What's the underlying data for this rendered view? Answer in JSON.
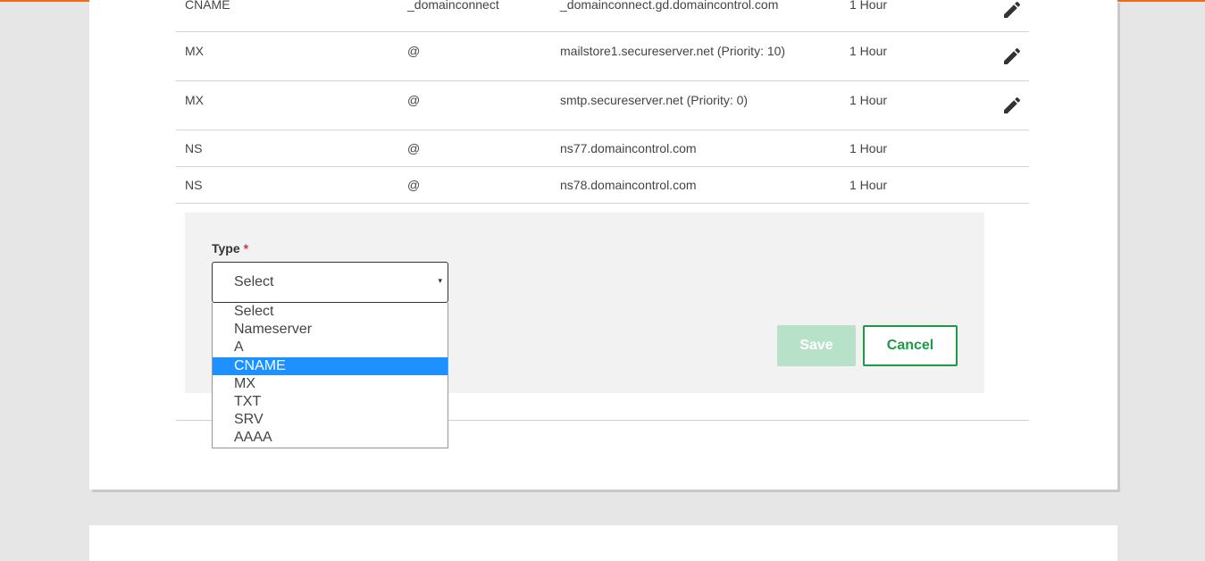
{
  "colors": {
    "accent": "#f16a17",
    "selected_option": "#1e90ff",
    "brand_green": "#1c9a47",
    "save_disabled": "#b7e1c9"
  },
  "records": [
    {
      "type": "CNAME",
      "name": "_domainconnect",
      "value": "_domainconnect.gd.domaincontrol.com",
      "ttl": "1 Hour",
      "editable": true
    },
    {
      "type": "MX",
      "name": "@",
      "value": "mailstore1.secureserver.net (Priority: 10)",
      "ttl": "1 Hour",
      "editable": true
    },
    {
      "type": "MX",
      "name": "@",
      "value": "smtp.secureserver.net (Priority: 0)",
      "ttl": "1 Hour",
      "editable": true
    },
    {
      "type": "NS",
      "name": "@",
      "value": "ns77.domaincontrol.com",
      "ttl": "1 Hour",
      "editable": false
    },
    {
      "type": "NS",
      "name": "@",
      "value": "ns78.domaincontrol.com",
      "ttl": "1 Hour",
      "editable": false
    }
  ],
  "form": {
    "type_label": "Type",
    "required_mark": "*",
    "select_value": "Select",
    "select_arrow": "▾",
    "options": [
      "Select",
      "Nameserver",
      "A",
      "CNAME",
      "MX",
      "TXT",
      "SRV",
      "AAAA"
    ],
    "highlighted_option": "CNAME",
    "save_label": "Save",
    "cancel_label": "Cancel"
  },
  "icons": {
    "edit": "pencil-icon"
  }
}
